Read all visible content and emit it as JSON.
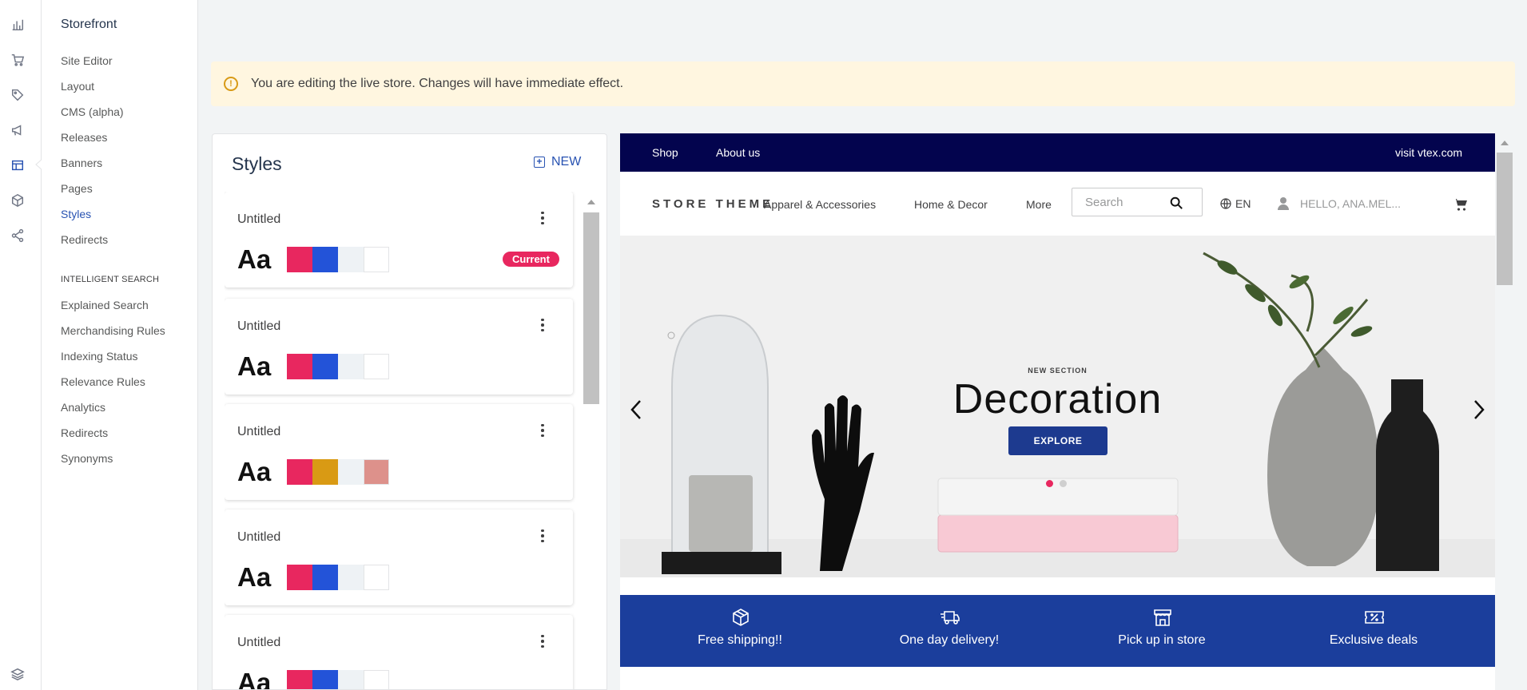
{
  "rail": {
    "icons": [
      "chart-icon",
      "cart-icon",
      "tag-icon",
      "megaphone-icon",
      "layout-icon",
      "box-icon",
      "share-icon",
      "layers-icon"
    ]
  },
  "subnav": {
    "title": "Storefront",
    "items": [
      "Site Editor",
      "Layout",
      "CMS (alpha)",
      "Releases",
      "Banners",
      "Pages",
      "Styles",
      "Redirects"
    ],
    "active": "Styles",
    "section_title": "INTELLIGENT SEARCH",
    "search_items": [
      "Explained Search",
      "Merchandising Rules",
      "Indexing Status",
      "Relevance Rules",
      "Analytics",
      "Redirects",
      "Synonyms"
    ]
  },
  "alert": {
    "text": "You are editing the live store. Changes will have immediate effect."
  },
  "styles": {
    "title": "Styles",
    "new_label": "NEW",
    "current_label": "Current",
    "cards": [
      {
        "name": "Untitled",
        "sample": "Aa",
        "colors": [
          "#e8275f",
          "#2353d8",
          "#eef2f5",
          "#ffffff"
        ],
        "current": true
      },
      {
        "name": "Untitled",
        "sample": "Aa",
        "colors": [
          "#e8275f",
          "#2353d8",
          "#eef2f5",
          "#ffffff"
        ],
        "current": false
      },
      {
        "name": "Untitled",
        "sample": "Aa",
        "colors": [
          "#e8275f",
          "#d99a14",
          "#eef2f5",
          "#dd918b"
        ],
        "current": false
      },
      {
        "name": "Untitled",
        "sample": "Aa",
        "colors": [
          "#e8275f",
          "#2353d8",
          "#eef2f5",
          "#ffffff"
        ],
        "current": false
      },
      {
        "name": "Untitled",
        "sample": "Aa",
        "colors": [
          "#e8275f",
          "#2353d8",
          "#eef2f5",
          "#ffffff"
        ],
        "current": false
      }
    ]
  },
  "preview": {
    "topbar": {
      "shop": "Shop",
      "about": "About us",
      "visit": "visit vtex.com"
    },
    "header": {
      "logo": "STORE THEME",
      "nav": [
        "Apparel & Accessories",
        "Home & Decor",
        "More"
      ],
      "search_placeholder": "Search",
      "language": "EN",
      "greeting": "HELLO, ANA.MEL..."
    },
    "hero": {
      "eyebrow": "NEW SECTION",
      "title": "Decoration",
      "button": "EXPLORE",
      "slide_count": 2,
      "active_slide": 1
    },
    "benefits": [
      "Free shipping!!",
      "One day delivery!",
      "Pick up in store",
      "Exclusive deals"
    ]
  },
  "colors": {
    "accent": "#2953b2",
    "topbar": "#03044e",
    "benefits_bar": "#1b3e9c",
    "pink": "#e8275f",
    "alert_bg": "#fff6e0"
  }
}
